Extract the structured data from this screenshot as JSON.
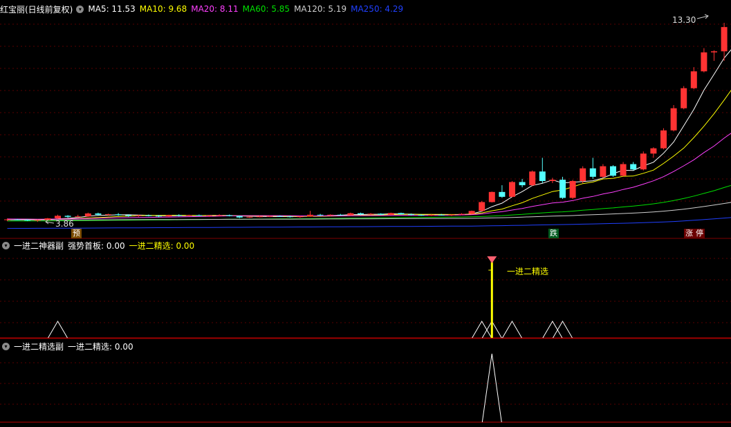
{
  "main": {
    "stock_name": "红宝丽(日线前复权)",
    "ma": [
      {
        "label": "MA5: 11.53",
        "color": "#ffffff"
      },
      {
        "label": "MA10: 9.68",
        "color": "#ffff00"
      },
      {
        "label": "MA20: 8.11",
        "color": "#ff40ff"
      },
      {
        "label": "MA60: 5.85",
        "color": "#00e000"
      },
      {
        "label": "MA120: 5.19",
        "color": "#d0d0d0"
      },
      {
        "label": "MA250: 4.29",
        "color": "#2040ff"
      }
    ],
    "high_label": "13.30",
    "low_label": "3.86",
    "badges": {
      "yu": "预",
      "die": "跌",
      "zhang": "涨",
      "ting": "停"
    },
    "colors": {
      "up": "#ff3333",
      "down": "#54ffff"
    }
  },
  "panel1": {
    "title": "一进二神器副",
    "items": [
      {
        "label": "强势首板: 0.00",
        "color": "#ffffff"
      },
      {
        "label": "一进二精选: 0.00",
        "color": "#ffff00"
      }
    ],
    "signal_label": "一进二精选"
  },
  "panel2": {
    "title": "一进二精选副",
    "items": [
      {
        "label": "一进二精选: 0.00",
        "color": "#ffffff"
      }
    ]
  },
  "chart_data": [
    {
      "type": "candlestick",
      "title": "红宝丽(日线前复权)",
      "ohlc": [
        [
          3.95,
          4.02,
          3.9,
          3.98
        ],
        [
          3.97,
          4.0,
          3.93,
          3.96
        ],
        [
          3.96,
          3.99,
          3.9,
          3.92
        ],
        [
          3.92,
          3.97,
          3.86,
          3.95
        ],
        [
          3.95,
          4.05,
          3.93,
          4.03
        ],
        [
          4.03,
          4.2,
          4.0,
          4.15
        ],
        [
          4.15,
          4.18,
          4.05,
          4.1
        ],
        [
          4.1,
          4.2,
          4.08,
          4.12
        ],
        [
          4.12,
          4.3,
          4.1,
          4.26
        ],
        [
          4.26,
          4.3,
          4.15,
          4.2
        ],
        [
          4.2,
          4.25,
          4.15,
          4.22
        ],
        [
          4.22,
          4.28,
          4.15,
          4.18
        ],
        [
          4.18,
          4.22,
          4.1,
          4.14
        ],
        [
          4.14,
          4.2,
          4.1,
          4.17
        ],
        [
          4.17,
          4.21,
          4.12,
          4.15
        ],
        [
          4.15,
          4.19,
          4.08,
          4.12
        ],
        [
          4.12,
          4.2,
          4.1,
          4.18
        ],
        [
          4.18,
          4.22,
          4.12,
          4.16
        ],
        [
          4.16,
          4.2,
          4.12,
          4.18
        ],
        [
          4.18,
          4.21,
          4.14,
          4.15
        ],
        [
          4.15,
          4.19,
          4.1,
          4.17
        ],
        [
          4.17,
          4.22,
          4.13,
          4.18
        ],
        [
          4.18,
          4.21,
          4.12,
          4.14
        ],
        [
          4.14,
          4.16,
          4.04,
          4.07
        ],
        [
          4.07,
          4.12,
          4.05,
          4.1
        ],
        [
          4.1,
          4.15,
          4.08,
          4.12
        ],
        [
          4.12,
          4.16,
          4.09,
          4.14
        ],
        [
          4.14,
          4.17,
          4.1,
          4.12
        ],
        [
          4.12,
          4.15,
          4.07,
          4.09
        ],
        [
          4.09,
          4.14,
          4.06,
          4.12
        ],
        [
          4.12,
          4.38,
          4.1,
          4.2
        ],
        [
          4.2,
          4.24,
          4.14,
          4.18
        ],
        [
          4.18,
          4.22,
          4.14,
          4.2
        ],
        [
          4.2,
          4.24,
          4.16,
          4.18
        ],
        [
          4.18,
          4.3,
          4.16,
          4.27
        ],
        [
          4.27,
          4.3,
          4.18,
          4.22
        ],
        [
          4.22,
          4.28,
          4.18,
          4.25
        ],
        [
          4.25,
          4.27,
          4.18,
          4.2
        ],
        [
          4.2,
          4.3,
          4.18,
          4.28
        ],
        [
          4.28,
          4.3,
          4.2,
          4.22
        ],
        [
          4.22,
          4.26,
          4.16,
          4.19
        ],
        [
          4.19,
          4.23,
          4.15,
          4.17
        ],
        [
          4.17,
          4.22,
          4.14,
          4.2
        ],
        [
          4.2,
          4.24,
          4.16,
          4.18
        ],
        [
          4.18,
          4.22,
          4.14,
          4.21
        ],
        [
          4.21,
          4.27,
          4.18,
          4.24
        ],
        [
          4.24,
          4.4,
          4.22,
          4.38
        ],
        [
          4.38,
          4.85,
          4.36,
          4.8
        ],
        [
          4.8,
          5.3,
          4.78,
          5.28
        ],
        [
          5.28,
          5.6,
          5.0,
          5.05
        ],
        [
          5.05,
          5.8,
          5.02,
          5.75
        ],
        [
          5.75,
          5.9,
          5.5,
          5.6
        ],
        [
          5.6,
          6.3,
          5.55,
          6.25
        ],
        [
          6.25,
          6.9,
          5.7,
          5.8
        ],
        [
          5.8,
          5.95,
          5.7,
          5.86
        ],
        [
          5.86,
          6.0,
          4.95,
          5.0
        ],
        [
          5.0,
          5.85,
          4.95,
          5.8
        ],
        [
          5.8,
          6.5,
          5.7,
          6.4
        ],
        [
          6.4,
          6.9,
          5.9,
          6.0
        ],
        [
          6.0,
          6.6,
          5.95,
          6.5
        ],
        [
          6.5,
          6.55,
          6.0,
          6.05
        ],
        [
          6.05,
          6.7,
          6.0,
          6.6
        ],
        [
          6.6,
          6.7,
          6.3,
          6.35
        ],
        [
          6.35,
          7.2,
          6.3,
          7.1
        ],
        [
          7.1,
          7.4,
          6.9,
          7.35
        ],
        [
          7.35,
          8.3,
          7.3,
          8.2
        ],
        [
          8.2,
          9.4,
          8.15,
          9.25
        ],
        [
          9.25,
          10.3,
          9.2,
          10.2
        ],
        [
          10.2,
          11.2,
          10.15,
          11.0
        ],
        [
          11.0,
          12.1,
          10.95,
          11.9
        ],
        [
          11.9,
          12.0,
          11.5,
          11.95
        ],
        [
          11.95,
          13.3,
          11.5,
          13.1
        ],
        [
          12.3,
          13.2,
          12.2,
          13.05
        ]
      ],
      "ma_labels": [
        "MA5",
        "MA10",
        "MA20",
        "MA60",
        "MA120",
        "MA250"
      ],
      "ma_end_values": [
        11.53,
        9.68,
        8.11,
        5.85,
        5.19,
        4.29
      ],
      "annotations": {
        "high": "13.30",
        "low": "3.86"
      }
    },
    {
      "type": "area",
      "title": "一进二神器副",
      "series": [
        {
          "name": "强势首板",
          "values": [
            0,
            0,
            0,
            0,
            0,
            1,
            0,
            0,
            0,
            0,
            0,
            0,
            0,
            0,
            0,
            0,
            0,
            0,
            0,
            0,
            0,
            0,
            0,
            0,
            0,
            0,
            0,
            0,
            0,
            0,
            0,
            0,
            0,
            0,
            0,
            0,
            0,
            0,
            0,
            0,
            0,
            0,
            0,
            0,
            0,
            0,
            0,
            1,
            1,
            0,
            1,
            0,
            0,
            0,
            1,
            1,
            0,
            0,
            0,
            0,
            0,
            0,
            0,
            0,
            0,
            0,
            0,
            0,
            0,
            0,
            0,
            0,
            0
          ]
        },
        {
          "name": "一进二精选",
          "values": [
            0,
            0,
            0,
            0,
            0,
            0,
            0,
            0,
            0,
            0,
            0,
            0,
            0,
            0,
            0,
            0,
            0,
            0,
            0,
            0,
            0,
            0,
            0,
            0,
            0,
            0,
            0,
            0,
            0,
            0,
            0,
            0,
            0,
            0,
            0,
            0,
            0,
            0,
            0,
            0,
            0,
            0,
            0,
            0,
            0,
            0,
            0,
            0,
            1,
            0,
            0,
            0,
            0,
            0,
            0,
            0,
            0,
            0,
            0,
            0,
            0,
            0,
            0,
            0,
            0,
            0,
            0,
            0,
            0,
            0,
            0,
            0,
            0
          ]
        }
      ]
    },
    {
      "type": "area",
      "title": "一进二精选副",
      "series": [
        {
          "name": "一进二精选",
          "values": [
            0,
            0,
            0,
            0,
            0,
            0,
            0,
            0,
            0,
            0,
            0,
            0,
            0,
            0,
            0,
            0,
            0,
            0,
            0,
            0,
            0,
            0,
            0,
            0,
            0,
            0,
            0,
            0,
            0,
            0,
            0,
            0,
            0,
            0,
            0,
            0,
            0,
            0,
            0,
            0,
            0,
            0,
            0,
            0,
            0,
            0,
            0,
            0,
            1,
            0,
            0,
            0,
            0,
            0,
            0,
            0,
            0,
            0,
            0,
            0,
            0,
            0,
            0,
            0,
            0,
            0,
            0,
            0,
            0,
            0,
            0,
            0,
            0
          ]
        }
      ]
    }
  ]
}
